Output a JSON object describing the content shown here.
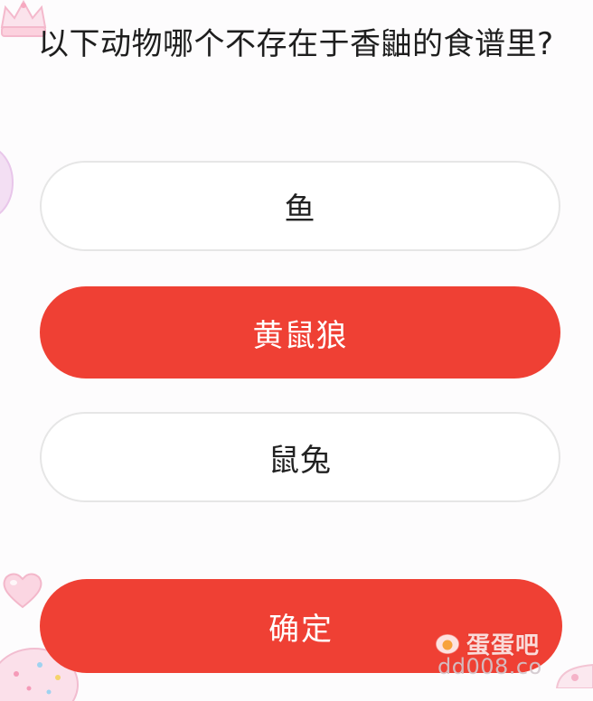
{
  "quiz": {
    "question": "以下动物哪个不存在于香鼬的食谱里?",
    "options": [
      {
        "label": "鱼",
        "selected": false
      },
      {
        "label": "黄鼠狼",
        "selected": true
      },
      {
        "label": "鼠兔",
        "selected": false
      }
    ],
    "confirm_label": "确定"
  },
  "watermark": {
    "name": "蛋蛋吧",
    "url": "dd008.co"
  },
  "colors": {
    "accent": "#ef4034",
    "option_border": "#e6e6e6",
    "background": "#fdfcfd",
    "question_text": "#1e1e1e"
  },
  "icons": [
    "crown-sticker-icon",
    "heart-sticker-icon",
    "donut-sticker-icon",
    "egg-logo-icon"
  ]
}
